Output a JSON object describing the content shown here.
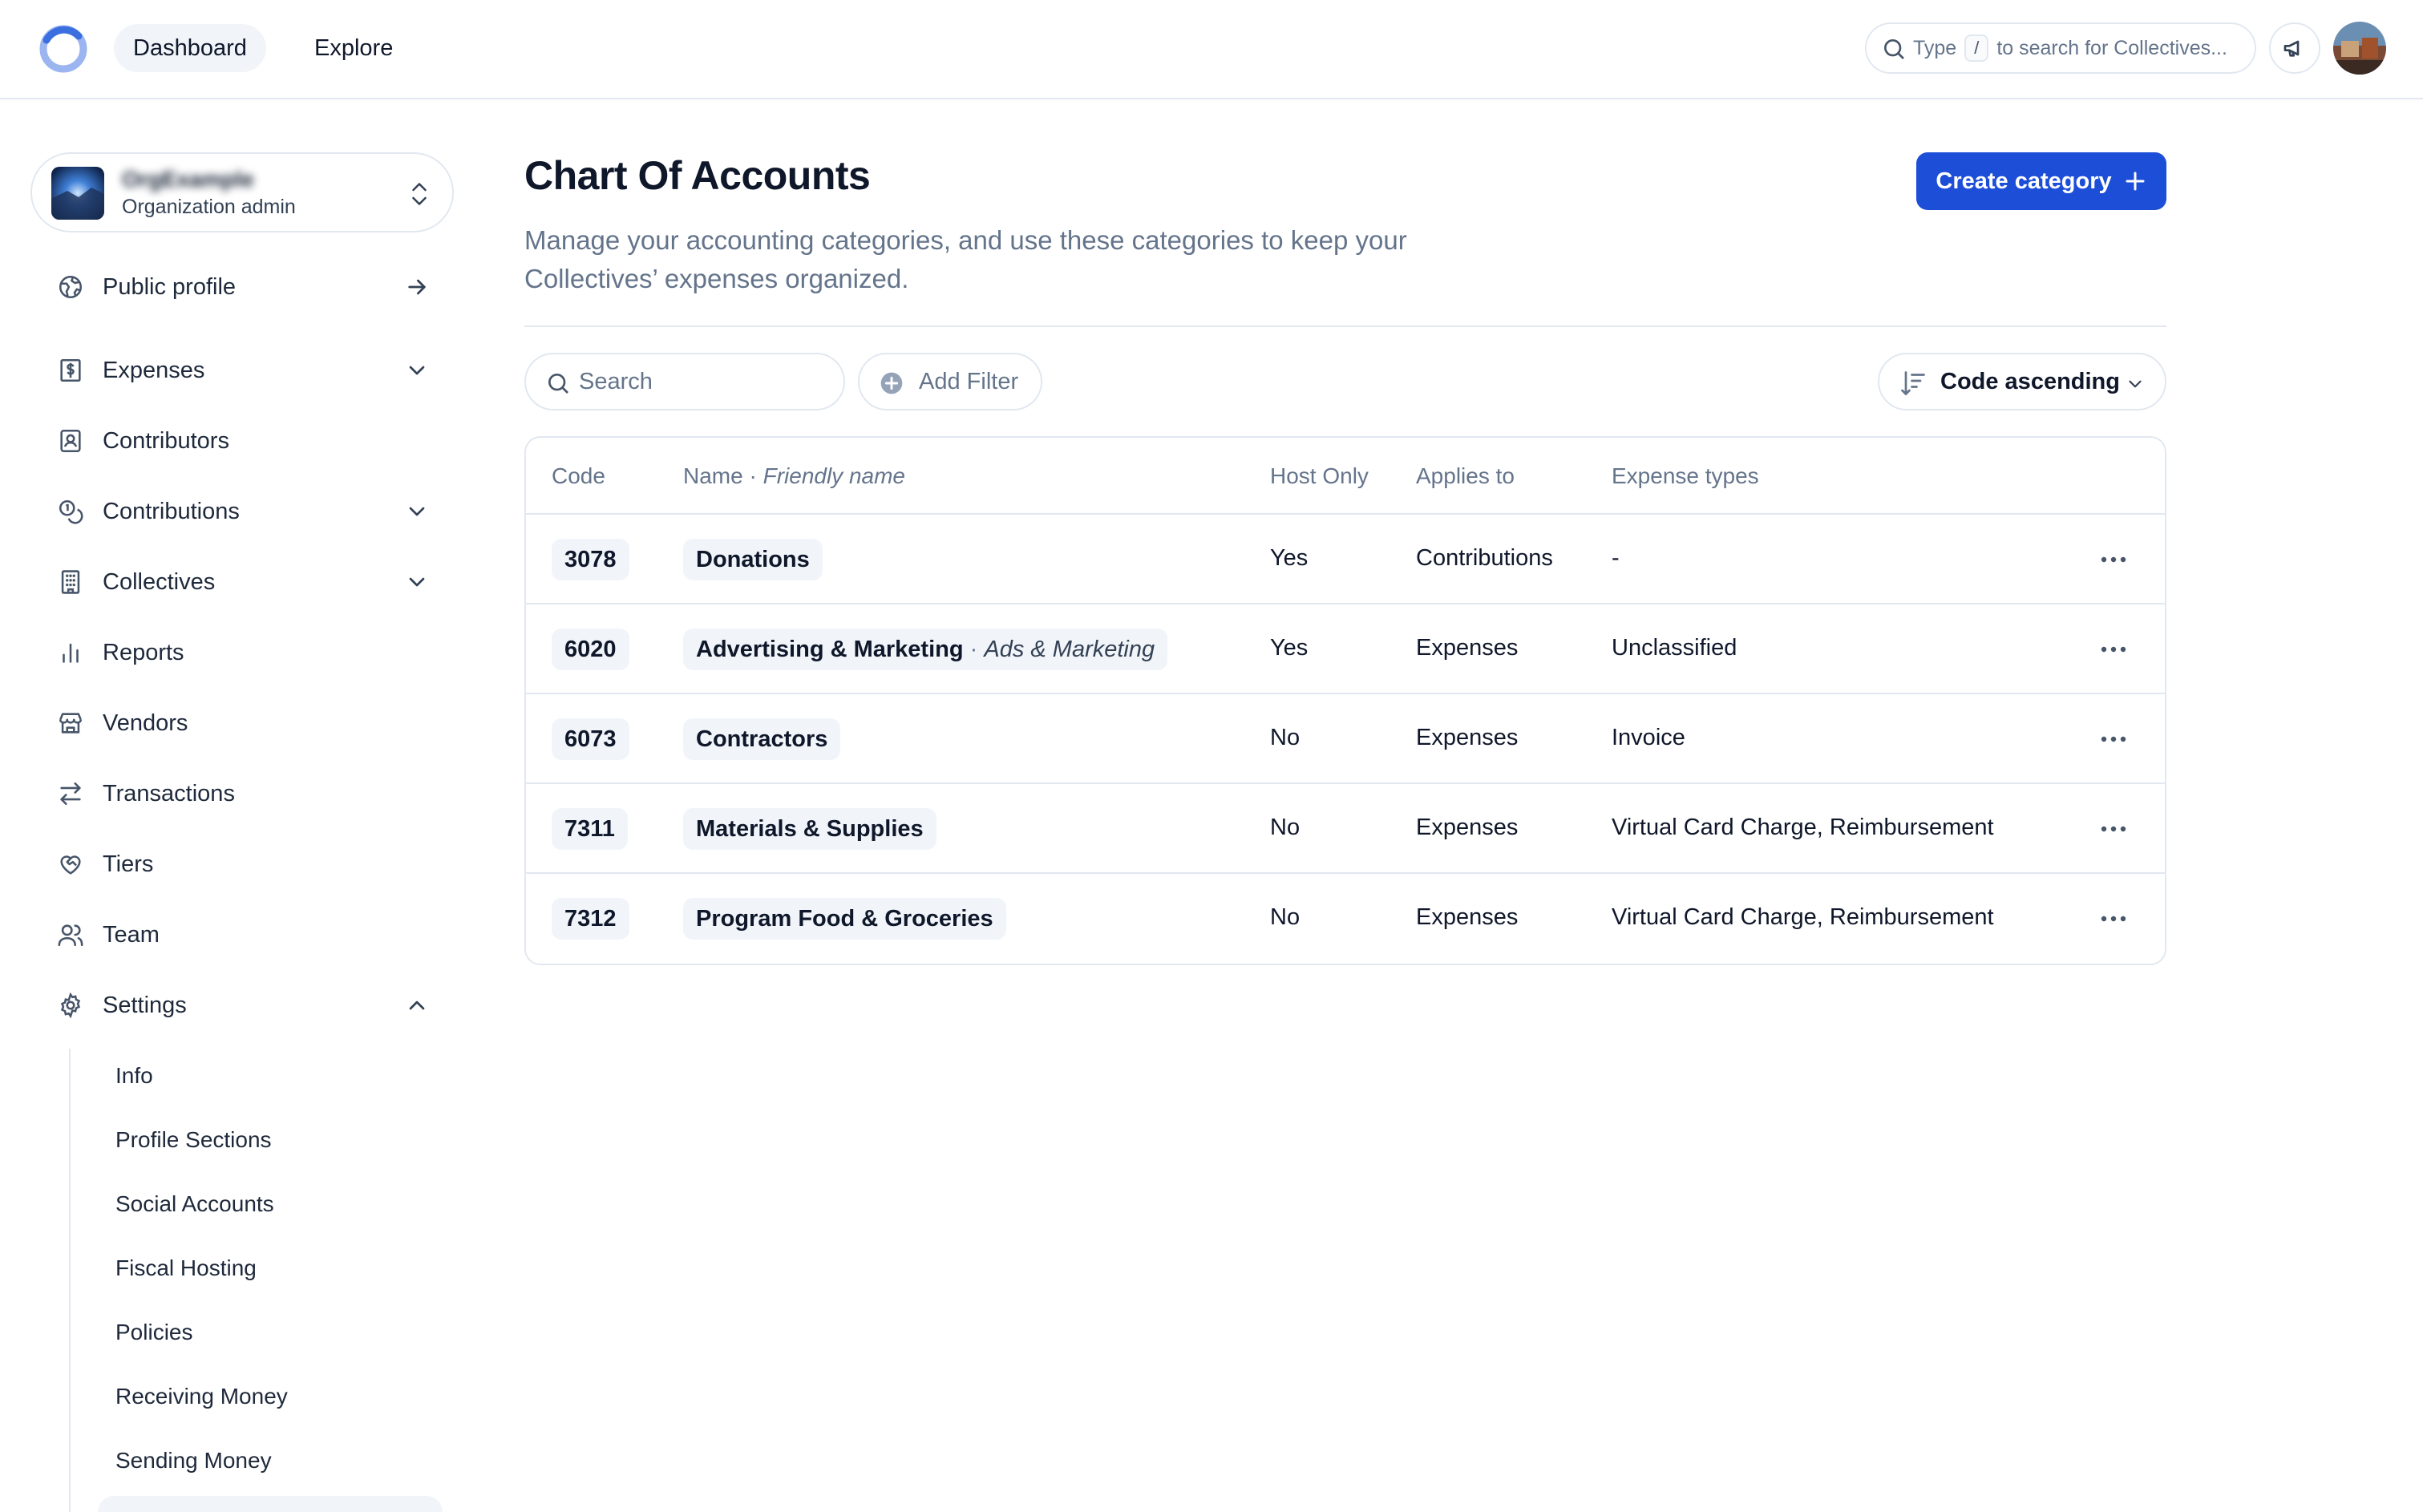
{
  "topbar": {
    "nav": [
      {
        "label": "Dashboard",
        "active": true
      },
      {
        "label": "Explore",
        "active": false
      }
    ],
    "search": {
      "prefix": "Type",
      "key": "/",
      "suffix": "to search for Collectives..."
    }
  },
  "sidebar": {
    "account": {
      "name": "OrgExample",
      "role": "Organization admin"
    },
    "items": [
      {
        "label": "Public profile",
        "icon": "globe-icon",
        "trail": "arrow-right"
      },
      {
        "label": "Expenses",
        "icon": "receipt-icon",
        "trail": "chevron-down"
      },
      {
        "label": "Contributors",
        "icon": "contact-icon",
        "trail": ""
      },
      {
        "label": "Contributions",
        "icon": "coins-icon",
        "trail": "chevron-down"
      },
      {
        "label": "Collectives",
        "icon": "building-icon",
        "trail": "chevron-down"
      },
      {
        "label": "Reports",
        "icon": "bar-chart-icon",
        "trail": ""
      },
      {
        "label": "Vendors",
        "icon": "store-icon",
        "trail": ""
      },
      {
        "label": "Transactions",
        "icon": "arrows-left-right-icon",
        "trail": ""
      },
      {
        "label": "Tiers",
        "icon": "heart-handshake-icon",
        "trail": ""
      },
      {
        "label": "Team",
        "icon": "users-icon",
        "trail": ""
      },
      {
        "label": "Settings",
        "icon": "gear-icon",
        "trail": "chevron-up"
      }
    ],
    "settings_items": [
      "Info",
      "Profile Sections",
      "Social Accounts",
      "Fiscal Hosting",
      "Policies",
      "Receiving Money",
      "Sending Money"
    ]
  },
  "main": {
    "title": "Chart Of Accounts",
    "description": "Manage your accounting categories, and use these categories to keep your Collectives’ expenses organized.",
    "create_label": "Create category",
    "search_placeholder": "Search",
    "add_filter_label": "Add Filter",
    "sort_label": "Code ascending",
    "table": {
      "columns": {
        "code": "Code",
        "name": "Name",
        "name_sep": "·",
        "friendly": "Friendly name",
        "host_only": "Host Only",
        "applies_to": "Applies to",
        "expense_types": "Expense types"
      },
      "rows": [
        {
          "code": "3078",
          "name": "Donations",
          "friendly": "",
          "host_only": "Yes",
          "applies_to": "Contributions",
          "expense_types": "-"
        },
        {
          "code": "6020",
          "name": "Advertising & Marketing",
          "friendly": "Ads & Marketing",
          "host_only": "Yes",
          "applies_to": "Expenses",
          "expense_types": "Unclassified"
        },
        {
          "code": "6073",
          "name": "Contractors",
          "friendly": "",
          "host_only": "No",
          "applies_to": "Expenses",
          "expense_types": "Invoice"
        },
        {
          "code": "7311",
          "name": "Materials & Supplies",
          "friendly": "",
          "host_only": "No",
          "applies_to": "Expenses",
          "expense_types": "Virtual Card Charge, Reimbursement"
        },
        {
          "code": "7312",
          "name": "Program Food & Groceries",
          "friendly": "",
          "host_only": "No",
          "applies_to": "Expenses",
          "expense_types": "Virtual Card Charge, Reimbursement"
        }
      ]
    }
  },
  "colors": {
    "accent": "#1d4ed8",
    "muted": "#64748b",
    "border": "#e2e8f0"
  }
}
